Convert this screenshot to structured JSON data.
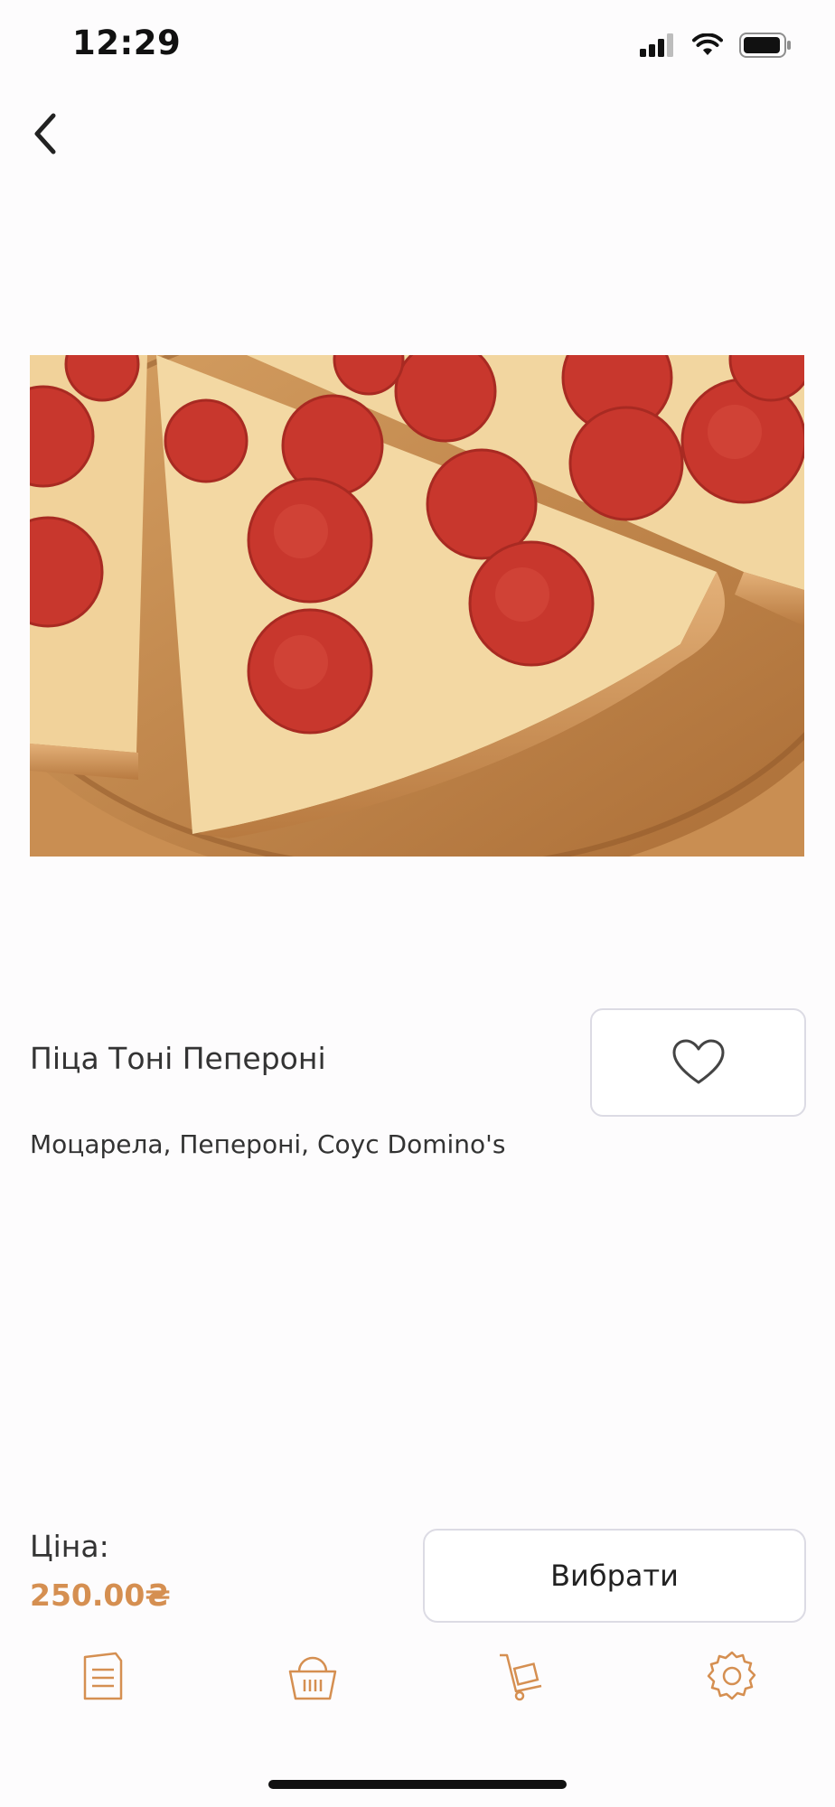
{
  "status_bar": {
    "time": "12:29"
  },
  "product": {
    "name": "Піца Тоні Пепероні",
    "ingredients": "Моцарела, Пепероні, Соус Domino's"
  },
  "price": {
    "label": "Ціна:",
    "value": "250.00₴"
  },
  "actions": {
    "choose_label": "Вибрати"
  },
  "tab_bar": {
    "items": [
      "menu-icon",
      "basket-icon",
      "cart-icon",
      "settings-icon"
    ]
  },
  "colors": {
    "accent": "#d58f51",
    "border": "#dcdbe4",
    "text": "#333333"
  }
}
